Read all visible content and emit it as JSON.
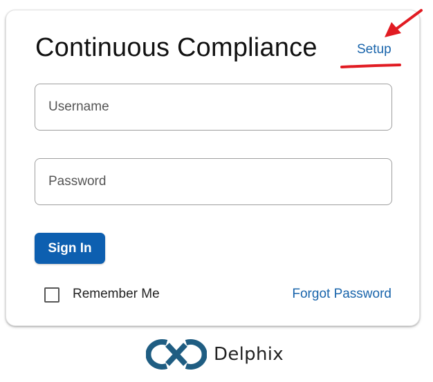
{
  "app": {
    "title": "Continuous Compliance",
    "setup_link": "Setup"
  },
  "form": {
    "username": {
      "placeholder": "Username",
      "value": ""
    },
    "password": {
      "placeholder": "Password",
      "value": ""
    },
    "signin_label": "Sign In",
    "remember_label": "Remember Me",
    "remember_checked": false,
    "forgot_label": "Forgot Password"
  },
  "brand": {
    "name": "Delphix",
    "logo_icon": "delphix-logo-icon",
    "logo_color": "#1f5d82"
  },
  "colors": {
    "primary": "#0d5fb0",
    "link": "#1864ab",
    "annotation": "#e11b22"
  }
}
